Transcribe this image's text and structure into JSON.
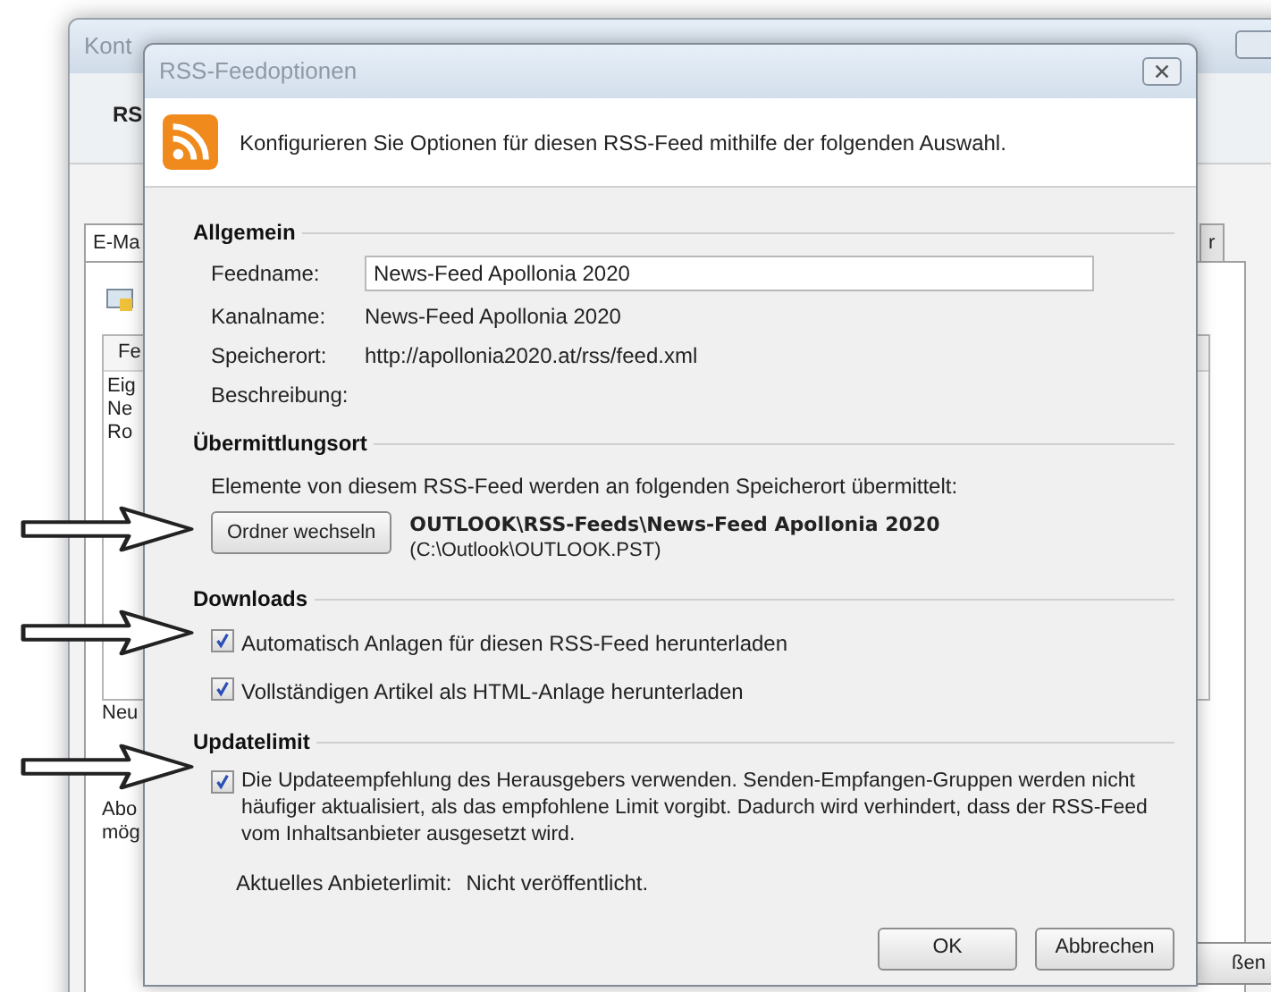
{
  "background_window": {
    "title": "Kont",
    "heading": "RS",
    "tabs": [
      {
        "label": "E-Ma",
        "selected": true
      },
      {
        "label": "r",
        "selected": false
      }
    ],
    "list_header": "Fe",
    "list_items": [
      "Eig",
      "Ne",
      "Ro"
    ],
    "label_new": "Neu",
    "text_lines": [
      "Abo",
      "mög"
    ],
    "button": "ßen"
  },
  "dialog": {
    "title": "RSS-Feedoptionen",
    "intro": "Konfigurieren Sie Optionen für diesen RSS-Feed mithilfe der folgenden Auswahl.",
    "general": {
      "heading": "Allgemein",
      "feedname_label": "Feedname:",
      "feedname_value": "News-Feed Apollonia 2020",
      "rows": [
        {
          "label": "Kanalname:",
          "value": "News-Feed Apollonia 2020"
        },
        {
          "label": "Speicherort:",
          "value": "http://apollonia2020.at/rss/feed.xml"
        },
        {
          "label": "Beschreibung:"
        }
      ]
    },
    "delivery": {
      "heading": "Übermittlungsort",
      "text": "Elemente von diesem RSS-Feed werden an folgenden Speicherort übermittelt:",
      "button": "Ordner wechseln",
      "folder": "OUTLOOK\\RSS-Feeds\\News-Feed Apollonia 2020",
      "file": "(C:\\Outlook\\OUTLOOK.PST)"
    },
    "downloads": {
      "heading": "Downloads",
      "options": [
        {
          "label": "Automatisch Anlagen für diesen RSS-Feed herunterladen",
          "checked": true
        },
        {
          "label": "Vollständigen Artikel als HTML-Anlage herunterladen",
          "checked": true
        }
      ]
    },
    "update_limit": {
      "heading": "Updatelimit",
      "option": {
        "label": "Die Updateempfehlung des Herausgebers verwenden. Senden-Empfangen-Gruppen werden nicht häufiger aktualisiert, als das empfohlene Limit vorgibt. Dadurch wird verhindert, dass der RSS-Feed vom Inhaltsanbieter ausgesetzt wird.",
        "checked": true
      },
      "limit_label": "Aktuelles Anbieterlimit:",
      "limit_value": "Nicht veröffentlicht."
    },
    "buttons": [
      "OK",
      "Abbrechen"
    ]
  }
}
